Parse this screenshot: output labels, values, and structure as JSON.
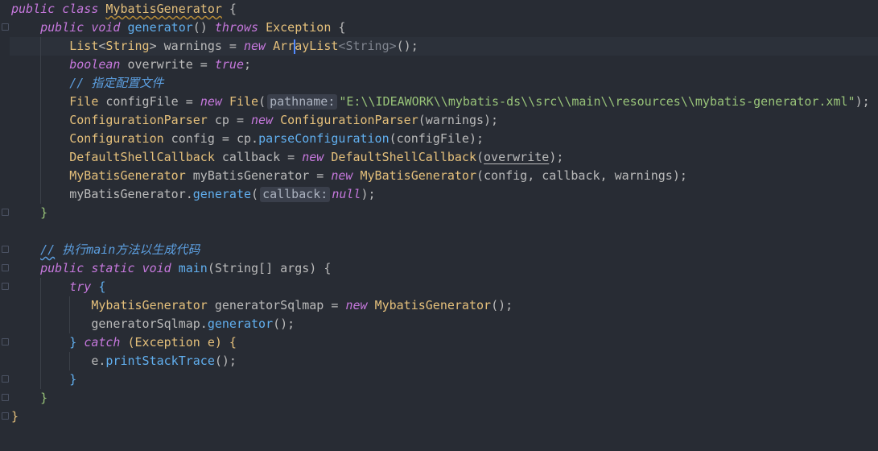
{
  "editor": {
    "class_decl": {
      "public": "public",
      "class": "class",
      "name": "MybatisGenerator",
      "brace": " {"
    },
    "method1": {
      "public": "public",
      "void": "void",
      "name": "generator",
      "parens": "()",
      "throws": "throws",
      "exception": "Exception",
      "brace": " {"
    },
    "l3": {
      "type": "List",
      "lt": "<",
      "generic": "String",
      "gt": ">",
      "rest": " warnings = ",
      "new": "new",
      "ctor_a": "Arr",
      "ctor_b": "ayList",
      "lt2": "<",
      "generic2": "String",
      "gt2": ">",
      "end": "();"
    },
    "l4": {
      "kw": "boolean",
      "rest": " overwrite = ",
      "value": "true",
      "end": ";"
    },
    "l5": {
      "comment": "// 指定配置文件"
    },
    "l6": {
      "type": "File",
      "rest": " configFile = ",
      "new": "new",
      "ctor": "File",
      "open": "(",
      "hint": "pathname:",
      "string": "\"E:\\\\IDEAWORK\\\\mybatis-ds\\\\src\\\\main\\\\resources\\\\mybatis-generator.xml\"",
      "end": ");"
    },
    "l7": {
      "type": "ConfigurationParser",
      "rest": " cp = ",
      "new": "new",
      "ctor": "ConfigurationParser",
      "args": "(warnings);"
    },
    "l8": {
      "type": "Configuration",
      "rest": " config = cp.",
      "method": "parseConfiguration",
      "args": "(configFile);"
    },
    "l9": {
      "type": "DefaultShellCallback",
      "rest": " callback = ",
      "new": "new",
      "ctor": "DefaultShellCallback",
      "open": "(",
      "arg": "overwrite",
      "end": ");"
    },
    "l10": {
      "type": "MyBatisGenerator",
      "rest": " myBatisGenerator = ",
      "new": "new",
      "ctor": "MyBatisGenerator",
      "args": "(config, callback, warnings);"
    },
    "l11": {
      "obj": "myBatisGenerator.",
      "method": "generate",
      "open": "(",
      "hint": "callback:",
      "value": "null",
      "end": ");"
    },
    "l12": {
      "text": "}"
    },
    "l14": {
      "slashes": "//",
      "comment": " 执行main方法以生成代码"
    },
    "method2": {
      "public": "public",
      "static": "static",
      "void": "void",
      "name": "main",
      "params": "(String[] args) {"
    },
    "l16": {
      "kw": "try",
      "brace": " {"
    },
    "l17": {
      "type": "MybatisGenerator",
      "rest": " generatorSqlmap = ",
      "new": "new",
      "ctor": "MybatisGenerator",
      "end": "();"
    },
    "l18": {
      "obj": "generatorSqlmap.",
      "method": "generator",
      "end": "();"
    },
    "l19": {
      "close": "} ",
      "kw": "catch",
      "rest": " (Exception e) {"
    },
    "l20": {
      "obj": "e.",
      "method": "printStackTrace",
      "end": "();"
    },
    "l21": {
      "text": "}"
    },
    "l22": {
      "text": "}"
    },
    "l23": {
      "text": "}"
    }
  },
  "colors": {
    "background": "#282c34",
    "keyword": "#c678dd",
    "type": "#e5c07b",
    "function": "#61afef",
    "string": "#98c379",
    "comment": "#5c9fe0"
  }
}
